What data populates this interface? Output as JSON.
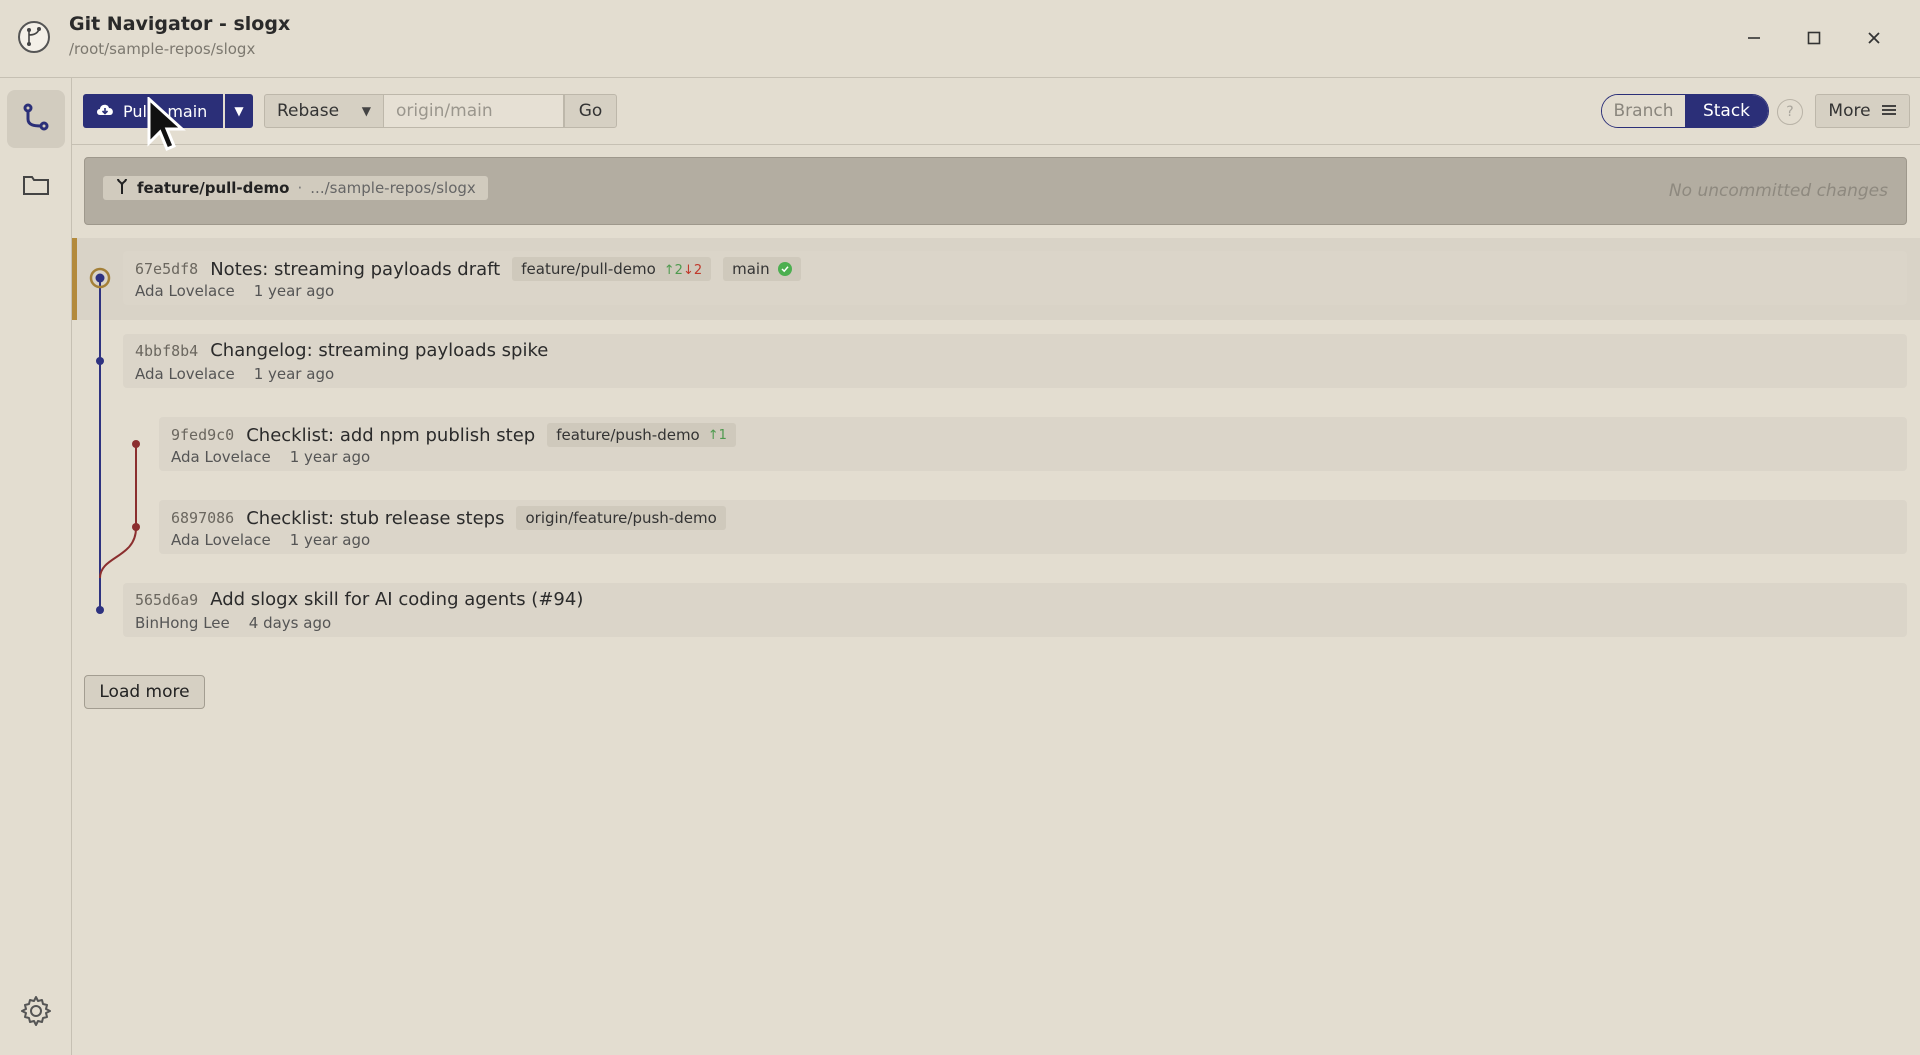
{
  "window": {
    "title": "Git Navigator - slogx",
    "path": "/root/sample-repos/slogx"
  },
  "toolbar": {
    "pull_label": "Pull - main",
    "mode": "Rebase",
    "target_placeholder": "origin/main",
    "go_label": "Go",
    "view_options": [
      "Branch",
      "Stack"
    ],
    "active_view": "Stack",
    "help_label": "?",
    "more_label": "More"
  },
  "status": {
    "branch": "feature/pull-demo",
    "separator": "·",
    "repo_path": ".../sample-repos/slogx",
    "message": "No uncommitted changes"
  },
  "commits": [
    {
      "sha": "67e5df8",
      "subject": "Notes: streaming payloads draft",
      "author": "Ada Lovelace",
      "time": "1 year ago",
      "refs": [
        {
          "name": "feature/pull-demo",
          "ahead": "↑2",
          "behind": "↓2"
        },
        {
          "name": "main"
        }
      ]
    },
    {
      "sha": "4bbf8b4",
      "subject": "Changelog: streaming payloads spike",
      "author": "Ada Lovelace",
      "time": "1 year ago"
    },
    {
      "sha": "9fed9c0",
      "subject": "Checklist: add npm publish step",
      "author": "Ada Lovelace",
      "time": "1 year ago",
      "refs": [
        {
          "name": "feature/push-demo",
          "ahead": "↑1"
        }
      ]
    },
    {
      "sha": "6897086",
      "subject": "Checklist: stub release steps",
      "author": "Ada Lovelace",
      "time": "1 year ago",
      "refs": [
        {
          "name": "origin/feature/push-demo"
        }
      ]
    },
    {
      "sha": "565d6a9",
      "subject": "Add slogx skill for AI coding agents (#94)",
      "author": "BinHong Lee",
      "time": "4 days ago"
    }
  ],
  "load_more_label": "Load more",
  "colors": {
    "accent": "#2b2f78",
    "head_marker": "#b38a3c",
    "graph_main": "#2e3280",
    "graph_branch": "#8b2e2e",
    "ahead": "#4e9a4e",
    "behind": "#c0392b"
  }
}
